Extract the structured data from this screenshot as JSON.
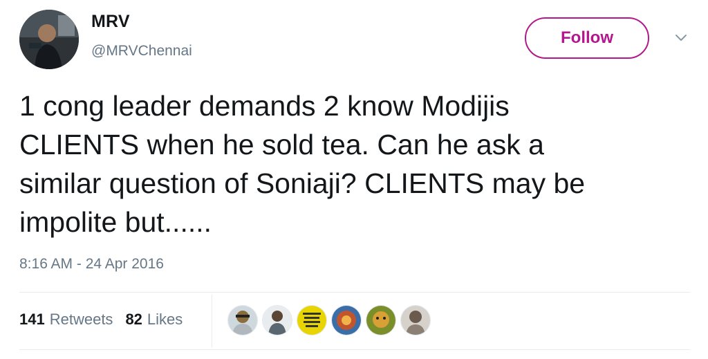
{
  "user": {
    "name": "MRV",
    "handle": "@MRVChennai"
  },
  "follow_label": "Follow",
  "tweet": {
    "text": "1 cong leader demands 2 know Modijis\nCLIENTS when he sold tea. Can he ask a\nsimilar question of Soniaji? CLIENTS may be\nimpolite but......",
    "timestamp": "8:16 AM - 24 Apr 2016"
  },
  "stats": {
    "retweets_count": "141",
    "retweets_label": "Retweets",
    "likes_count": "82",
    "likes_label": "Likes"
  },
  "likers": [
    {
      "name": "liker-avatar-1",
      "color": "#8a6d3b"
    },
    {
      "name": "liker-avatar-2",
      "color": "#5b6770"
    },
    {
      "name": "liker-avatar-3",
      "color": "#e8d400"
    },
    {
      "name": "liker-avatar-4",
      "color": "#c2552b"
    },
    {
      "name": "liker-avatar-5",
      "color": "#7a8f2a"
    },
    {
      "name": "liker-avatar-6",
      "color": "#6b5a4e"
    }
  ],
  "colors": {
    "accent": "#b4178d",
    "text": "#14171a",
    "muted": "#657786",
    "divider": "#e6ecf0"
  },
  "icons": {
    "caret": "chevron-down-icon"
  }
}
